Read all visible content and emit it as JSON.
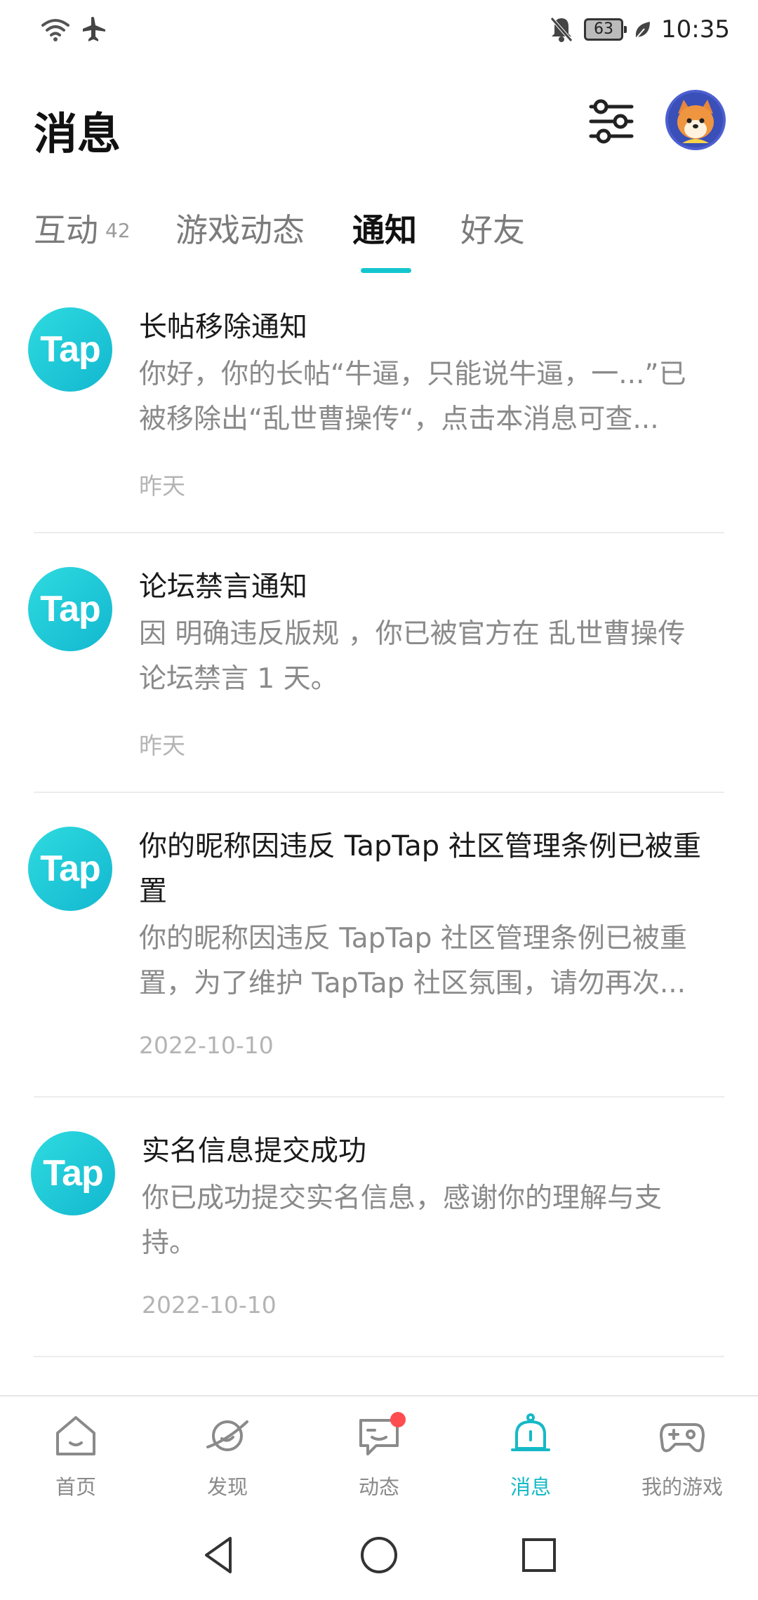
{
  "status_bar": {
    "battery": "63",
    "time": "10:35",
    "icons": [
      "wifi-icon",
      "airplane-icon",
      "mute-icon",
      "battery-icon",
      "leaf-icon"
    ]
  },
  "header": {
    "title": "消息",
    "filter_icon": "sliders-icon",
    "avatar_icon": "user-avatar"
  },
  "tabs": [
    {
      "label": "互动",
      "count": "42"
    },
    {
      "label": "游戏动态"
    },
    {
      "label": "通知",
      "active": true
    },
    {
      "label": "好友"
    }
  ],
  "notifications": [
    {
      "logo": "Tap",
      "title": "长帖移除通知",
      "body_lines": [
        "你好，你的长帖“牛逼，只能说牛逼，一...”已",
        "被移除出“乱世曹操传“，点击本消息可查..."
      ],
      "time": "昨天"
    },
    {
      "logo": "Tap",
      "title": "论坛禁言通知",
      "body_lines": [
        "因 明确违反版规 ，你已被官方在 乱世曹操传",
        "论坛禁言 1 天。"
      ],
      "time": "昨天"
    },
    {
      "logo": "Tap",
      "title_lines": [
        "你的昵称因违反 TapTap 社区管理条例已被重",
        "置"
      ],
      "body_lines": [
        "你的昵称因违反 TapTap 社区管理条例已被重",
        "置，为了维护 TapTap 社区氛围，请勿再次..."
      ],
      "time": "2022-10-10"
    },
    {
      "logo": "Tap",
      "title": "实名信息提交成功",
      "body_lines": [
        "你已成功提交实名信息，感谢你的理解与支",
        "持。"
      ],
      "time": "2022-10-10"
    }
  ],
  "bottom_nav": [
    {
      "label": "首页",
      "icon": "home-icon"
    },
    {
      "label": "发现",
      "icon": "planet-icon"
    },
    {
      "label": "动态",
      "icon": "chat-icon",
      "badge": true
    },
    {
      "label": "消息",
      "icon": "bell-icon",
      "active": true
    },
    {
      "label": "我的游戏",
      "icon": "gamepad-icon"
    }
  ],
  "colors": {
    "accent": "#15c5ce",
    "badge": "#ff4d4f",
    "logo_gradient_start": "#2fdbe0",
    "logo_gradient_end": "#12b7cf"
  }
}
